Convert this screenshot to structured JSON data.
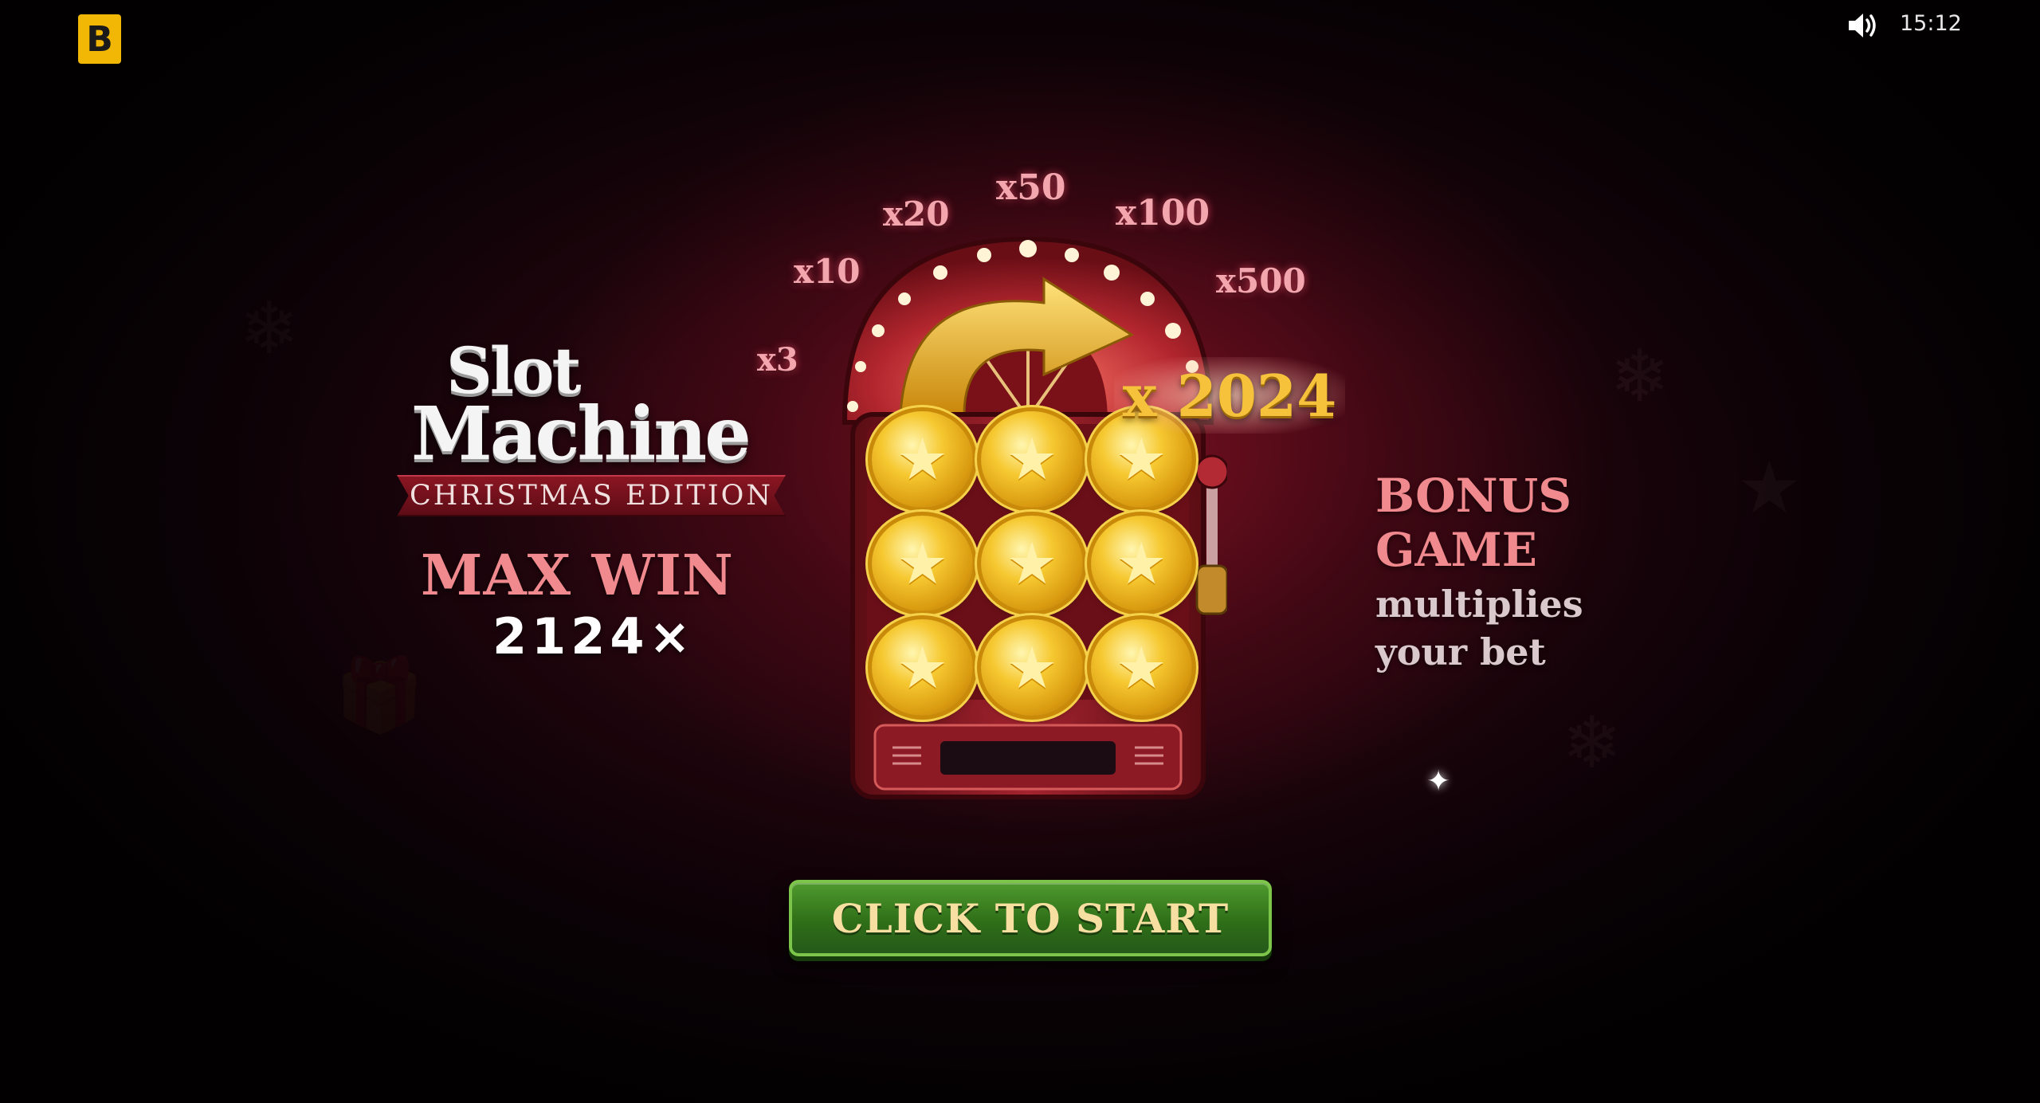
{
  "top_bar": {
    "logo_letter": "B",
    "sound_icon": "speaker-icon",
    "time": "15:12"
  },
  "game": {
    "title_line1": "Slot",
    "title_line2": "Machine",
    "edition": "CHRISTMAS EDITION",
    "max_win_label": "MAX WIN",
    "max_win_value": "2124×"
  },
  "multipliers": [
    "x3",
    "x10",
    "x20",
    "x50",
    "x100",
    "x500"
  ],
  "big_multiplier": "x 2024",
  "bonus": {
    "heading_line1": "BONUS",
    "heading_line2": "GAME",
    "sub_line1": "multiplies",
    "sub_line2": "your bet"
  },
  "reels": {
    "symbol": "star-coin-icon",
    "count": 9
  },
  "start_button": {
    "label": "CLICK TO START"
  },
  "colors": {
    "accent_pink": "#f08a8e",
    "gold": "#f6c23c",
    "button_green": "#2f6f18",
    "logo_yellow": "#f2b705"
  }
}
